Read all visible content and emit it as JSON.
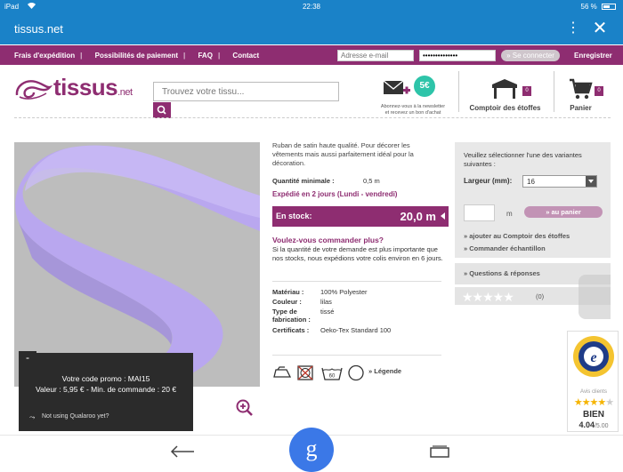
{
  "status": {
    "device": "iPad",
    "time": "22:38",
    "battery": "56 %"
  },
  "browser": {
    "title": "tissus.net",
    "menu_glyph": "⋮",
    "close_glyph": "✕"
  },
  "nav": {
    "links": [
      "Frais d'expédition",
      "Possibilités de paiement",
      "FAQ",
      "Contact"
    ],
    "email_placeholder": "Adresse e-mail",
    "password_value": "••••••••••••••",
    "connect_label": "» Se connecter",
    "register_label": "Enregistrer"
  },
  "header": {
    "logo_text": "tissus",
    "logo_suffix": ".net",
    "search_placeholder": "Trouvez votre tissu...",
    "newsletter_badge": "5€",
    "newsletter_line1": "Abonnez-vous à la newsletter",
    "newsletter_line2": "et recevez un bon d'achat",
    "comptoir_label": "Comptoir des étoffes",
    "comptoir_count": "0",
    "panier_label": "Panier",
    "panier_count": "0"
  },
  "product": {
    "description": "Ruban de satin haute qualité. Pour décorer les vêtements mais aussi parfaitement idéal pour la décoration.",
    "qmin_label": "Quantité minimale :",
    "qmin_value": "0,5   m",
    "shipping": "Expédié en 2 jours (Lundi - vendredi)",
    "stock_label": "En stock:",
    "stock_value": "20,0  m",
    "order_q": "Voulez-vous commander plus?",
    "order_text": "Si la quantité de votre demande est plus importante que nos stocks, nous expédions votre colis environ en 6 jours.",
    "specs": [
      {
        "k": "Matériau :",
        "v": "100% Polyester"
      },
      {
        "k": "Couleur :",
        "v": "lilas"
      },
      {
        "k": "Type de fabrication :",
        "v": "tissé"
      },
      {
        "k": "Certificats :",
        "v": "Oeko-Tex Standard 100"
      }
    ],
    "wash_temp": "60",
    "legend_label": "» Légende",
    "colors": {
      "ribbon": "#b9a7ef",
      "ribbon_dark": "#9d86e6",
      "background": "#bdbdbd"
    }
  },
  "variants": {
    "title": "Veuillez sélectionner l'une des variantes suivantes :",
    "width_label": "Largeur (mm):",
    "width_value": "16",
    "qty_unit": "m",
    "add_label": "» au panier",
    "link_comptoir": "» ajouter au Comptoir des étoffes",
    "link_sample": "» Commander échantillon",
    "qa_label": "» Questions & réponses",
    "rating_count": "(0)",
    "rating_stars": "★★★★★"
  },
  "trusted": {
    "seal_letter": "e",
    "avis_label": "Avis clients",
    "stars": "★★★★",
    "verdict": "BIEN",
    "score": "4.04",
    "score_max": "/5.00"
  },
  "promo": {
    "minimize": "-",
    "code_line": "Votre code promo : MAI15",
    "value_line": "Valeur : 5,95 € - Min. de commande : 20 €",
    "qualaroo": "Not using Qualaroo yet?"
  },
  "bottom": {
    "google_letter": "g"
  },
  "theme": {
    "brand": "#8e2d71",
    "chrome_blue": "#1a82c8"
  }
}
